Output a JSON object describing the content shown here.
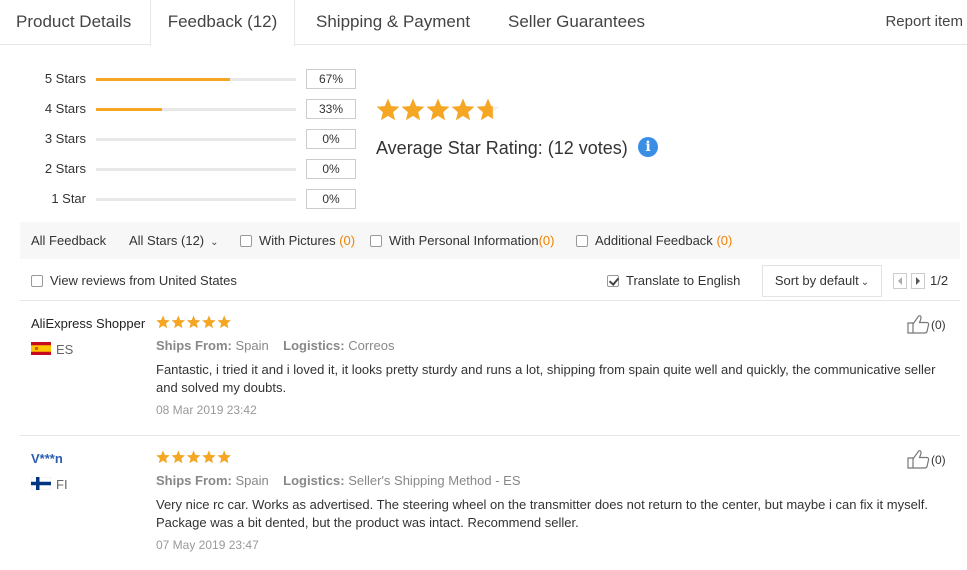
{
  "tabs": [
    {
      "label": "Product Details"
    },
    {
      "label": "Feedback (12)"
    },
    {
      "label": "Shipping & Payment"
    },
    {
      "label": "Seller Guarantees"
    }
  ],
  "report_label": "Report item",
  "histogram": [
    {
      "label": "5 Stars",
      "percent": 67,
      "percent_text": "67%"
    },
    {
      "label": "4 Stars",
      "percent": 33,
      "percent_text": "33%"
    },
    {
      "label": "3 Stars",
      "percent": 0,
      "percent_text": "0%"
    },
    {
      "label": "2 Stars",
      "percent": 0,
      "percent_text": "0%"
    },
    {
      "label": "1 Star",
      "percent": 0,
      "percent_text": "0%"
    }
  ],
  "average": {
    "text": "Average Star Rating:  (12 votes)",
    "rating_stars": 4.7,
    "info_glyph": "i"
  },
  "filters": {
    "all_feedback": "All Feedback",
    "all_stars": "All Stars (12)",
    "with_pictures": "With Pictures",
    "with_pictures_count": "0",
    "with_personal": "With Personal Information",
    "with_personal_count": "0",
    "additional": "Additional Feedback",
    "additional_count": "0",
    "view_us": "View reviews from United States",
    "translate": "Translate to English",
    "sort": "Sort by default",
    "page": "1/2"
  },
  "colors": {
    "accent": "#f5a623",
    "link_blue": "#2a5db0",
    "count_orange": "#f08200"
  },
  "reviews": [
    {
      "name": "AliExpress Shopper",
      "country": "ES",
      "flag_icon": "spain-flag-icon",
      "stars": 5,
      "ships_from_label": "Ships From:",
      "ships_from": "Spain",
      "logistics_label": "Logistics:",
      "logistics": "Correos",
      "text": "Fantastic, i tried it and i loved it, it looks pretty sturdy and runs a lot, shipping from spain quite well and quickly, the communicative seller and solved my doubts.",
      "date": "08 Mar 2019 23:42",
      "helpful": "(0)"
    },
    {
      "name": "V***n",
      "country": "FI",
      "flag_icon": "finland-flag-icon",
      "stars": 5,
      "ships_from_label": "Ships From:",
      "ships_from": "Spain",
      "logistics_label": "Logistics:",
      "logistics": "Seller's Shipping Method - ES",
      "text": "Very nice rc car. Works as advertised. The steering wheel on the transmitter does not return to the center, but maybe i can fix it myself. Package was a bit dented, but the product was intact. Recommend seller.",
      "date": "07 May 2019 23:47",
      "helpful": "(0)"
    }
  ]
}
